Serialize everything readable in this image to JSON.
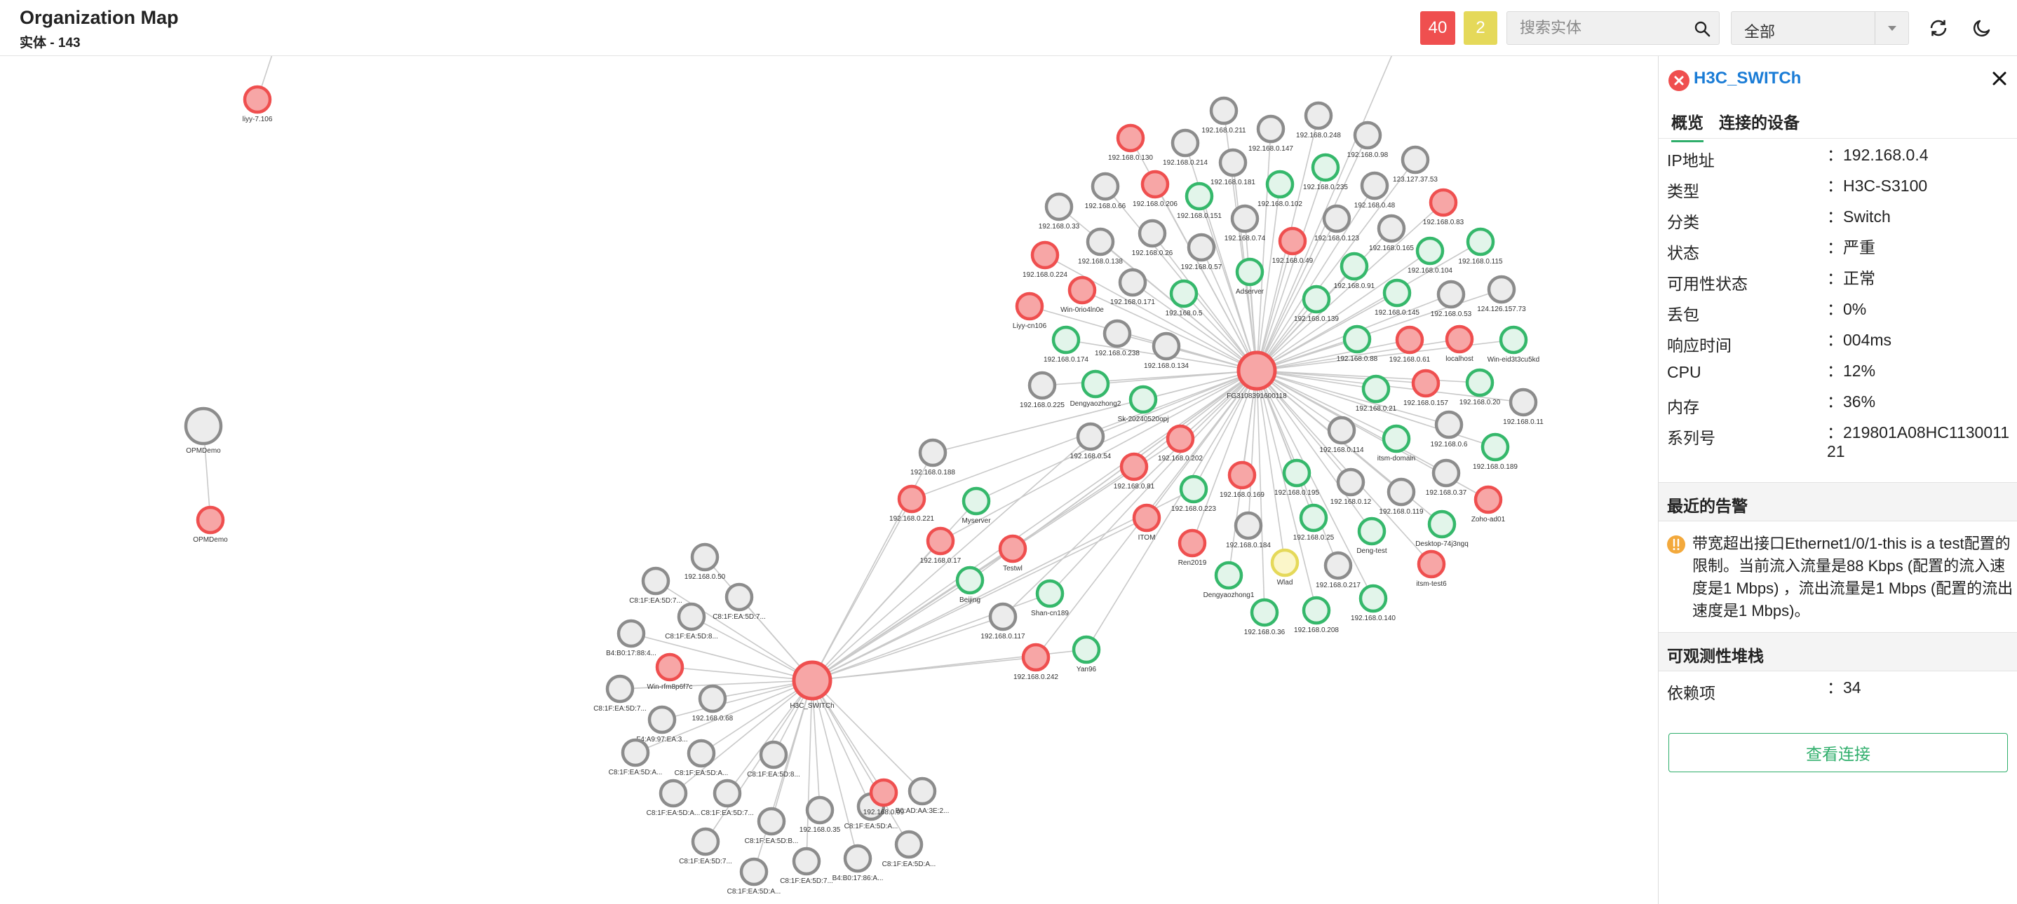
{
  "header": {
    "title": "Organization Map",
    "subtitle": "实体 - 143",
    "badge_critical": "40",
    "badge_warning": "2",
    "search_placeholder": "搜索实体",
    "filter_value": "全部"
  },
  "colors": {
    "critical": "#ef4f4f",
    "ok": "#35b86b",
    "unknown": "#8c8c8c",
    "warning": "#e5d95a",
    "accent": "#1a7cd6"
  },
  "icons": [
    "search-icon",
    "chevron-down-icon",
    "refresh-icon",
    "moon-icon",
    "error-icon",
    "close-icon",
    "warning-icon"
  ],
  "map": {
    "nodes": [
      {
        "label": "liyy-7.106",
        "status": "critical"
      },
      {
        "label": "OPMDemo",
        "status": "unknown"
      },
      {
        "label": "OPMDemo",
        "status": "critical"
      },
      {
        "label": "FG3108391600118",
        "status": "critical"
      },
      {
        "label": "H3C_SWITCh",
        "status": "critical"
      },
      {
        "label": "192.168.0.211",
        "status": "unknown"
      },
      {
        "label": "192.168.0.130",
        "status": "critical"
      },
      {
        "label": "192.168.0.147",
        "status": "unknown"
      },
      {
        "label": "192.168.0.248",
        "status": "unknown"
      },
      {
        "label": "192.168.0.214",
        "status": "unknown"
      },
      {
        "label": "192.168.0.98",
        "status": "unknown"
      },
      {
        "label": "192.168.0.181",
        "status": "unknown"
      },
      {
        "label": "192.168.0.235",
        "status": "ok"
      },
      {
        "label": "123.127.37.53",
        "status": "unknown"
      },
      {
        "label": "192.168.0.66",
        "status": "unknown"
      },
      {
        "label": "192.168.0.206",
        "status": "critical"
      },
      {
        "label": "192.168.0.151",
        "status": "ok"
      },
      {
        "label": "192.168.0.102",
        "status": "ok"
      },
      {
        "label": "192.168.0.48",
        "status": "unknown"
      },
      {
        "label": "192.168.0.83",
        "status": "critical"
      },
      {
        "label": "192.168.0.33",
        "status": "unknown"
      },
      {
        "label": "192.168.0.74",
        "status": "unknown"
      },
      {
        "label": "192.168.0.123",
        "status": "unknown"
      },
      {
        "label": "192.168.0.165",
        "status": "unknown"
      },
      {
        "label": "192.168.0.115",
        "status": "ok"
      },
      {
        "label": "192.168.0.138",
        "status": "unknown"
      },
      {
        "label": "192.168.0.26",
        "status": "unknown"
      },
      {
        "label": "192.168.0.49",
        "status": "critical"
      },
      {
        "label": "192.168.0.104",
        "status": "ok"
      },
      {
        "label": "192.168.0.224",
        "status": "critical"
      },
      {
        "label": "192.168.0.57",
        "status": "unknown"
      },
      {
        "label": "Adserver",
        "status": "ok"
      },
      {
        "label": "192.168.0.91",
        "status": "ok"
      },
      {
        "label": "Win-0rio4ln0e",
        "status": "critical"
      },
      {
        "label": "192.168.0.171",
        "status": "unknown"
      },
      {
        "label": "192.168.0.5",
        "status": "ok"
      },
      {
        "label": "192.168.0.139",
        "status": "ok"
      },
      {
        "label": "192.168.0.145",
        "status": "ok"
      },
      {
        "label": "192.168.0.53",
        "status": "unknown"
      },
      {
        "label": "124.126.157.73",
        "status": "unknown"
      },
      {
        "label": "Liyy-cn106",
        "status": "critical"
      },
      {
        "label": "192.168.0.174",
        "status": "ok"
      },
      {
        "label": "192.168.0.238",
        "status": "unknown"
      },
      {
        "label": "192.168.0.134",
        "status": "unknown"
      },
      {
        "label": "192.168.0.88",
        "status": "ok"
      },
      {
        "label": "192.168.0.61",
        "status": "critical"
      },
      {
        "label": "localhost",
        "status": "critical"
      },
      {
        "label": "Win-eid3t3cu5kd",
        "status": "ok"
      },
      {
        "label": "192.168.0.225",
        "status": "unknown"
      },
      {
        "label": "Dengyaozhong2",
        "status": "ok"
      },
      {
        "label": "Sk-20240520opj",
        "status": "ok"
      },
      {
        "label": "192.168.0.21",
        "status": "ok"
      },
      {
        "label": "192.168.0.157",
        "status": "critical"
      },
      {
        "label": "192.168.0.20",
        "status": "ok"
      },
      {
        "label": "192.168.0.11",
        "status": "unknown"
      },
      {
        "label": "192.168.0.188",
        "status": "unknown"
      },
      {
        "label": "192.168.0.54",
        "status": "unknown"
      },
      {
        "label": "192.168.0.202",
        "status": "critical"
      },
      {
        "label": "192.168.0.114",
        "status": "unknown"
      },
      {
        "label": "itsm-domain",
        "status": "ok"
      },
      {
        "label": "192.168.0.6",
        "status": "unknown"
      },
      {
        "label": "192.168.0.189",
        "status": "ok"
      },
      {
        "label": "192.168.0.81",
        "status": "critical"
      },
      {
        "label": "192.168.0.169",
        "status": "critical"
      },
      {
        "label": "192.168.0.195",
        "status": "ok"
      },
      {
        "label": "192.168.0.12",
        "status": "unknown"
      },
      {
        "label": "192.168.0.119",
        "status": "unknown"
      },
      {
        "label": "192.168.0.37",
        "status": "unknown"
      },
      {
        "label": "Zoho-ad01",
        "status": "critical"
      },
      {
        "label": "192.168.0.221",
        "status": "critical"
      },
      {
        "label": "Myserver",
        "status": "ok"
      },
      {
        "label": "192.168.0.223",
        "status": "ok"
      },
      {
        "label": "ITOM",
        "status": "critical"
      },
      {
        "label": "192.168.0.184",
        "status": "unknown"
      },
      {
        "label": "192.168.0.25",
        "status": "ok"
      },
      {
        "label": "Deng-test",
        "status": "ok"
      },
      {
        "label": "Desktop-74j3ngq",
        "status": "ok"
      },
      {
        "label": "192.168.0.17",
        "status": "critical"
      },
      {
        "label": "Testwl",
        "status": "critical"
      },
      {
        "label": "Ren2019",
        "status": "critical"
      },
      {
        "label": "Wlad",
        "status": "warning"
      },
      {
        "label": "192.168.0.217",
        "status": "unknown"
      },
      {
        "label": "itsm-test6",
        "status": "critical"
      },
      {
        "label": "Beijing",
        "status": "ok"
      },
      {
        "label": "Shan-cn189",
        "status": "ok"
      },
      {
        "label": "Dengyaozhong1",
        "status": "ok"
      },
      {
        "label": "192.168.0.140",
        "status": "ok"
      },
      {
        "label": "192.168.0.117",
        "status": "unknown"
      },
      {
        "label": "192.168.0.36",
        "status": "ok"
      },
      {
        "label": "192.168.0.208",
        "status": "ok"
      },
      {
        "label": "Yan96",
        "status": "ok"
      },
      {
        "label": "192.168.0.242",
        "status": "critical"
      },
      {
        "label": "192.168.0.50",
        "status": "unknown"
      },
      {
        "label": "C8:1F:EA:5D:7...",
        "status": "unknown"
      },
      {
        "label": "C8:1F:EA:5D:7...",
        "status": "unknown"
      },
      {
        "label": "C8:1F:EA:5D:8...",
        "status": "unknown"
      },
      {
        "label": "B4:B0:17:88:4...",
        "status": "unknown"
      },
      {
        "label": "Win-rfm8p6f7c",
        "status": "critical"
      },
      {
        "label": "C8:1F:EA:5D:7...",
        "status": "unknown"
      },
      {
        "label": "192.168.0.68",
        "status": "unknown"
      },
      {
        "label": "F4:A9:97:EA:3...",
        "status": "unknown"
      },
      {
        "label": "C8:1F:EA:5D:A...",
        "status": "unknown"
      },
      {
        "label": "C8:1F:EA:5D:A...",
        "status": "unknown"
      },
      {
        "label": "C8:1F:EA:5D:8...",
        "status": "unknown"
      },
      {
        "label": "C8:1F:EA:5D:A...",
        "status": "unknown"
      },
      {
        "label": "C8:1F:EA:5D:7...",
        "status": "unknown"
      },
      {
        "label": "C8:1F:EA:5D:B...",
        "status": "unknown"
      },
      {
        "label": "192.168.0.35",
        "status": "unknown"
      },
      {
        "label": "C8:1F:EA:5D:A...",
        "status": "unknown"
      },
      {
        "label": "192.168.0.99",
        "status": "critical"
      },
      {
        "label": "B0:AD:AA:3E:2...",
        "status": "unknown"
      },
      {
        "label": "C8:1F:EA:5D:7...",
        "status": "unknown"
      },
      {
        "label": "C8:1F:EA:5D:A...",
        "status": "unknown"
      },
      {
        "label": "C8:1F:EA:5D:7...",
        "status": "unknown"
      },
      {
        "label": "B4:B0:17:86:A...",
        "status": "unknown"
      },
      {
        "label": "C8:1F:EA:5D:A...",
        "status": "unknown"
      }
    ]
  },
  "panel": {
    "title": "H3C_SWITCh",
    "tabs": [
      "概览",
      "连接的设备"
    ],
    "properties": [
      {
        "key": "IP地址",
        "value": "192.168.0.4"
      },
      {
        "key": "类型",
        "value": "H3C-S3100"
      },
      {
        "key": "分类",
        "value": "Switch"
      },
      {
        "key": "状态",
        "value": "严重"
      },
      {
        "key": "可用性状态",
        "value": "正常"
      },
      {
        "key": "丢包",
        "value": "0%"
      },
      {
        "key": "响应时间",
        "value": "004ms"
      },
      {
        "key": "CPU",
        "value": "12%"
      },
      {
        "key": "内存",
        "value": "36%"
      },
      {
        "key": "系列号",
        "value": "219801A08HC113001121"
      }
    ],
    "separator": "：",
    "alerts_heading": "最近的告警",
    "alert_text": "带宽超出接口Ethernet1/0/1-this is a test配置的限制。当前流入流量是88 Kbps (配置的流入速度是1 Mbps) ，流出流量是1 Mbps (配置的流出速度是1 Mbps)。",
    "stack_heading": "可观测性堆栈",
    "dependency_key": "依赖项",
    "dependency_value": "34",
    "view_button": "查看连接"
  }
}
